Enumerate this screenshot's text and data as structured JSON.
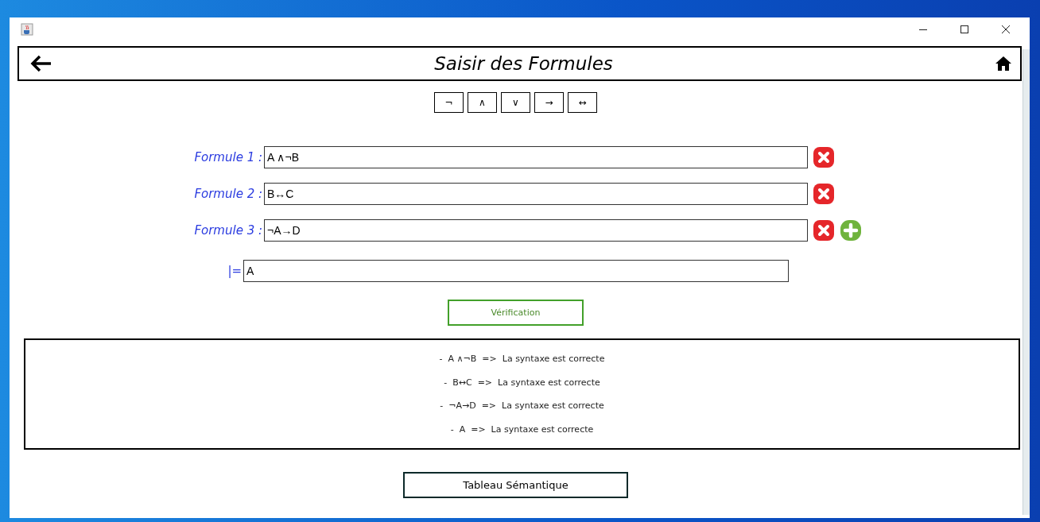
{
  "header": {
    "title": "Saisir des Formules"
  },
  "symbols": [
    "¬",
    "∧",
    "∨",
    "→",
    "↔"
  ],
  "formulas": [
    {
      "label": "Formule 1 :",
      "value": "A ∧¬B",
      "add_button": false
    },
    {
      "label": "Formule 2 :",
      "value": "B↔C",
      "add_button": false
    },
    {
      "label": "Formule 3 :",
      "value": "¬A→D",
      "add_button": true
    }
  ],
  "conclusion": {
    "label": "|=",
    "value": "A"
  },
  "verify_button": "Vérification",
  "results": [
    "-  A ∧¬B  =>  La syntaxe est correcte",
    "-  B↔C  =>  La syntaxe est correcte",
    "-  ¬A→D  =>  La syntaxe est correcte",
    "-  A  =>  La syntaxe est correcte"
  ],
  "table_button": "Tableau Sémantique"
}
